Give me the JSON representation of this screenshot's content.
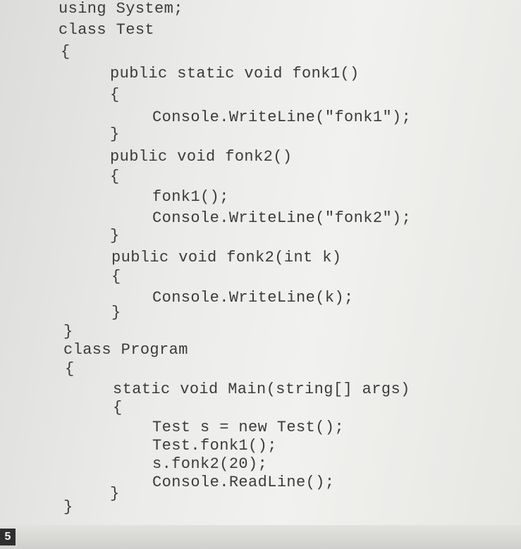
{
  "code": {
    "lines": [
      "using System;",
      "class Test",
      "{",
      "public static void fonk1()",
      "{",
      "Console.WriteLine(\"fonk1\");",
      "}",
      "public void fonk2()",
      "{",
      "fonk1();",
      "Console.WriteLine(\"fonk2\");",
      "}",
      "public void fonk2(int k)",
      "{",
      "Console.WriteLine(k);",
      "}",
      "}",
      "class Program",
      "{",
      "static void Main(string[] args)",
      "{",
      "Test s = new Test();",
      "Test.fonk1();",
      "s.fonk2(20);",
      "Console.ReadLine();",
      "}",
      "}"
    ]
  },
  "page_badge": "5"
}
